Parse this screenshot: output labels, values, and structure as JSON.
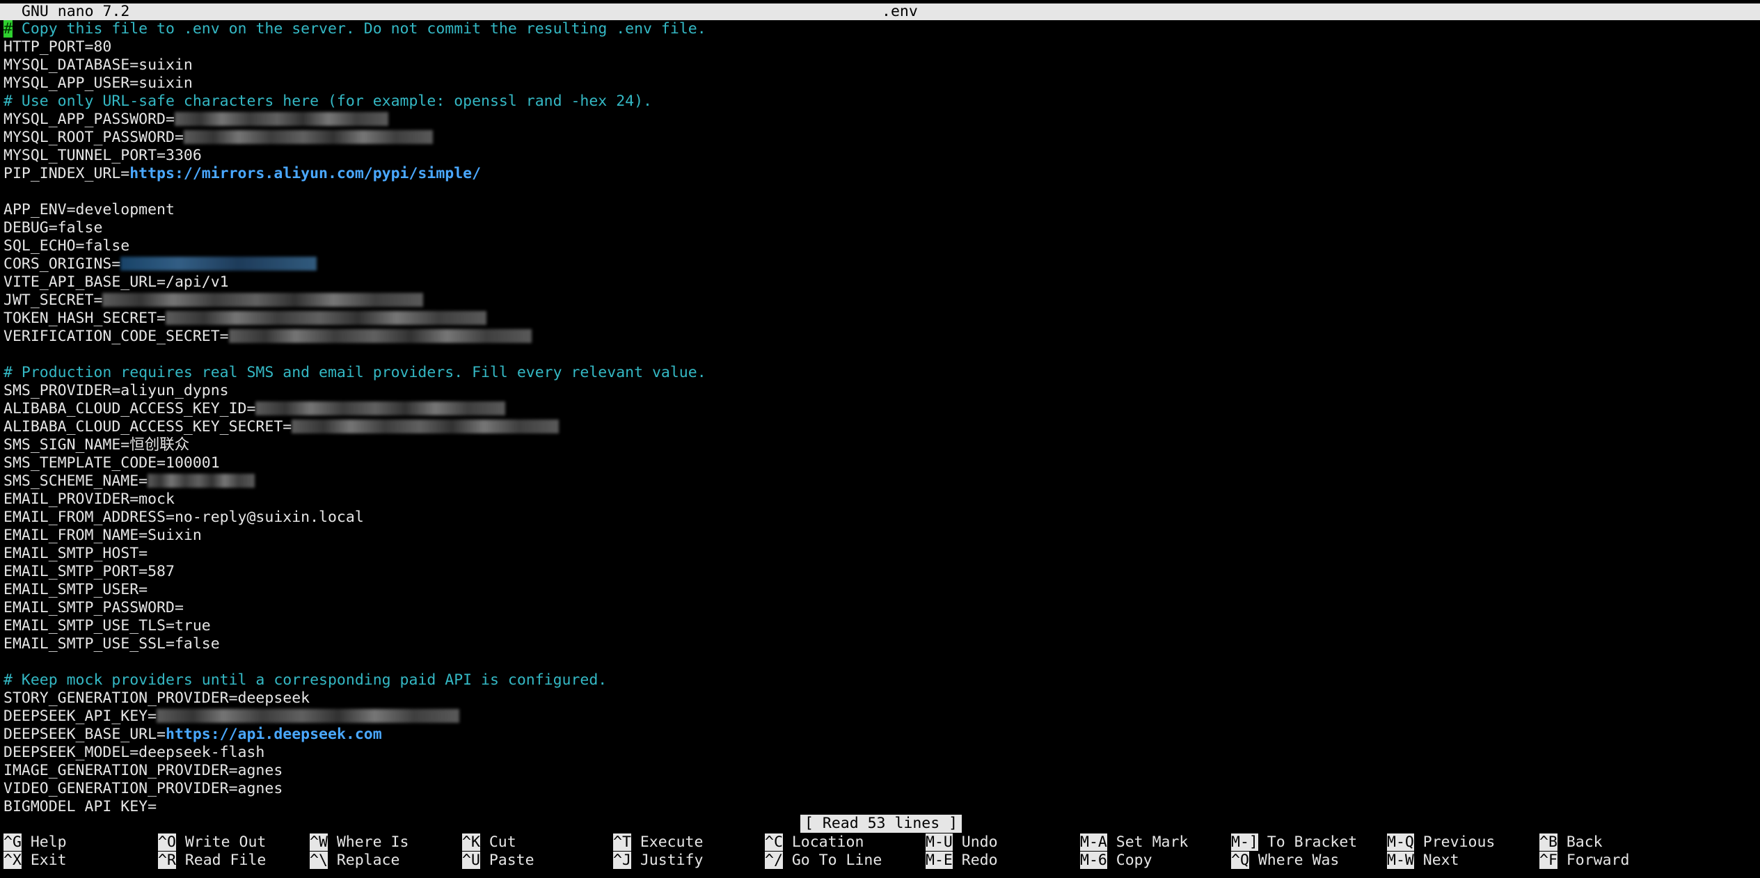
{
  "titlebar": {
    "app": "GNU nano 7.2",
    "filename": ".env"
  },
  "lines": [
    {
      "parts": [
        {
          "t": "#",
          "c": "cursor"
        },
        {
          "t": " Copy this file to .env on the server. Do not commit the resulting .env file.",
          "c": "comment"
        }
      ]
    },
    {
      "parts": [
        {
          "t": "HTTP_PORT=80"
        }
      ]
    },
    {
      "parts": [
        {
          "t": "MYSQL_DATABASE=suixin"
        }
      ]
    },
    {
      "parts": [
        {
          "t": "MYSQL_APP_USER=suixin"
        }
      ]
    },
    {
      "parts": [
        {
          "t": "# Use only URL-safe characters here (for example: openssl rand -hex 24).",
          "c": "comment"
        }
      ]
    },
    {
      "parts": [
        {
          "t": "MYSQL_APP_PASSWORD="
        },
        {
          "redact": 12
        }
      ]
    },
    {
      "parts": [
        {
          "t": "MYSQL_ROOT_PASSWORD="
        },
        {
          "redact": 14
        }
      ]
    },
    {
      "parts": [
        {
          "t": "MYSQL_TUNNEL_PORT=3306"
        }
      ]
    },
    {
      "parts": [
        {
          "t": "PIP_INDEX_URL="
        },
        {
          "t": "https://mirrors.aliyun.com/pypi/simple/",
          "c": "url"
        }
      ]
    },
    {
      "parts": [
        {
          "t": ""
        }
      ]
    },
    {
      "parts": [
        {
          "t": "APP_ENV=development"
        }
      ]
    },
    {
      "parts": [
        {
          "t": "DEBUG=false"
        }
      ]
    },
    {
      "parts": [
        {
          "t": "SQL_ECHO=false"
        }
      ]
    },
    {
      "parts": [
        {
          "t": "CORS_ORIGINS="
        },
        {
          "redact": 11,
          "blue": true
        }
      ]
    },
    {
      "parts": [
        {
          "t": "VITE_API_BASE_URL=/api/v1"
        }
      ]
    },
    {
      "parts": [
        {
          "t": "JWT_SECRET="
        },
        {
          "redact": 18
        }
      ]
    },
    {
      "parts": [
        {
          "t": "TOKEN_HASH_SECRET="
        },
        {
          "redact": 18
        }
      ]
    },
    {
      "parts": [
        {
          "t": "VERIFICATION_CODE_SECRET="
        },
        {
          "redact": 17
        }
      ]
    },
    {
      "parts": [
        {
          "t": ""
        }
      ]
    },
    {
      "parts": [
        {
          "t": "# Production requires real SMS and email providers. Fill every relevant value.",
          "c": "comment"
        }
      ]
    },
    {
      "parts": [
        {
          "t": "SMS_PROVIDER=aliyun_dypns"
        }
      ]
    },
    {
      "parts": [
        {
          "t": "ALIBABA_CLOUD_ACCESS_KEY_ID="
        },
        {
          "redact": 14
        }
      ]
    },
    {
      "parts": [
        {
          "t": "ALIBABA_CLOUD_ACCESS_KEY_SECRET="
        },
        {
          "redact": 15
        }
      ]
    },
    {
      "parts": [
        {
          "t": "SMS_SIGN_NAME=恒创联众"
        }
      ]
    },
    {
      "parts": [
        {
          "t": "SMS_TEMPLATE_CODE=100001"
        }
      ]
    },
    {
      "parts": [
        {
          "t": "SMS_SCHEME_NAME="
        },
        {
          "redact": 6
        }
      ]
    },
    {
      "parts": [
        {
          "t": "EMAIL_PROVIDER=mock"
        }
      ]
    },
    {
      "parts": [
        {
          "t": "EMAIL_FROM_ADDRESS=no-reply@suixin.local"
        }
      ]
    },
    {
      "parts": [
        {
          "t": "EMAIL_FROM_NAME=Suixin"
        }
      ]
    },
    {
      "parts": [
        {
          "t": "EMAIL_SMTP_HOST="
        }
      ]
    },
    {
      "parts": [
        {
          "t": "EMAIL_SMTP_PORT=587"
        }
      ]
    },
    {
      "parts": [
        {
          "t": "EMAIL_SMTP_USER="
        }
      ]
    },
    {
      "parts": [
        {
          "t": "EMAIL_SMTP_PASSWORD="
        }
      ]
    },
    {
      "parts": [
        {
          "t": "EMAIL_SMTP_USE_TLS=true"
        }
      ]
    },
    {
      "parts": [
        {
          "t": "EMAIL_SMTP_USE_SSL=false"
        }
      ]
    },
    {
      "parts": [
        {
          "t": ""
        }
      ]
    },
    {
      "parts": [
        {
          "t": "# Keep mock providers until a corresponding paid API is configured.",
          "c": "comment"
        }
      ]
    },
    {
      "parts": [
        {
          "t": "STORY_GENERATION_PROVIDER=deepseek"
        }
      ]
    },
    {
      "parts": [
        {
          "t": "DEEPSEEK_API_KEY="
        },
        {
          "redact": 17
        }
      ]
    },
    {
      "parts": [
        {
          "t": "DEEPSEEK_BASE_URL="
        },
        {
          "t": "https://api.deepseek.com",
          "c": "url"
        }
      ]
    },
    {
      "parts": [
        {
          "t": "DEEPSEEK_MODEL=deepseek-flash"
        }
      ]
    },
    {
      "parts": [
        {
          "t": "IMAGE_GENERATION_PROVIDER=agnes"
        }
      ]
    },
    {
      "parts": [
        {
          "t": "VIDEO_GENERATION_PROVIDER=agnes"
        }
      ]
    },
    {
      "parts": [
        {
          "t": "BIGMODEL_API_KEY="
        }
      ]
    }
  ],
  "status": "[ Read 53 lines ]",
  "shortcuts": [
    {
      "key": "^G",
      "label": "Help",
      "name": "help"
    },
    {
      "key": "^X",
      "label": "Exit",
      "name": "exit"
    },
    {
      "key": "^O",
      "label": "Write Out",
      "name": "write-out"
    },
    {
      "key": "^R",
      "label": "Read File",
      "name": "read-file"
    },
    {
      "key": "^W",
      "label": "Where Is",
      "name": "where-is"
    },
    {
      "key": "^\\",
      "label": "Replace",
      "name": "replace"
    },
    {
      "key": "^K",
      "label": "Cut",
      "name": "cut"
    },
    {
      "key": "^U",
      "label": "Paste",
      "name": "paste"
    },
    {
      "key": "^T",
      "label": "Execute",
      "name": "execute"
    },
    {
      "key": "^J",
      "label": "Justify",
      "name": "justify"
    },
    {
      "key": "^C",
      "label": "Location",
      "name": "location"
    },
    {
      "key": "^/",
      "label": "Go To Line",
      "name": "go-to-line"
    },
    {
      "key": "M-U",
      "label": "Undo",
      "name": "undo"
    },
    {
      "key": "M-E",
      "label": "Redo",
      "name": "redo"
    },
    {
      "key": "M-A",
      "label": "Set Mark",
      "name": "set-mark"
    },
    {
      "key": "M-6",
      "label": "Copy",
      "name": "copy"
    },
    {
      "key": "M-]",
      "label": "To Bracket",
      "name": "to-bracket"
    },
    {
      "key": "^Q",
      "label": "Where Was",
      "name": "where-was"
    },
    {
      "key": "M-Q",
      "label": "Previous",
      "name": "previous"
    },
    {
      "key": "M-W",
      "label": "Next",
      "name": "next"
    },
    {
      "key": "^B",
      "label": "Back",
      "name": "back"
    },
    {
      "key": "^F",
      "label": "Forward",
      "name": "forward"
    }
  ]
}
